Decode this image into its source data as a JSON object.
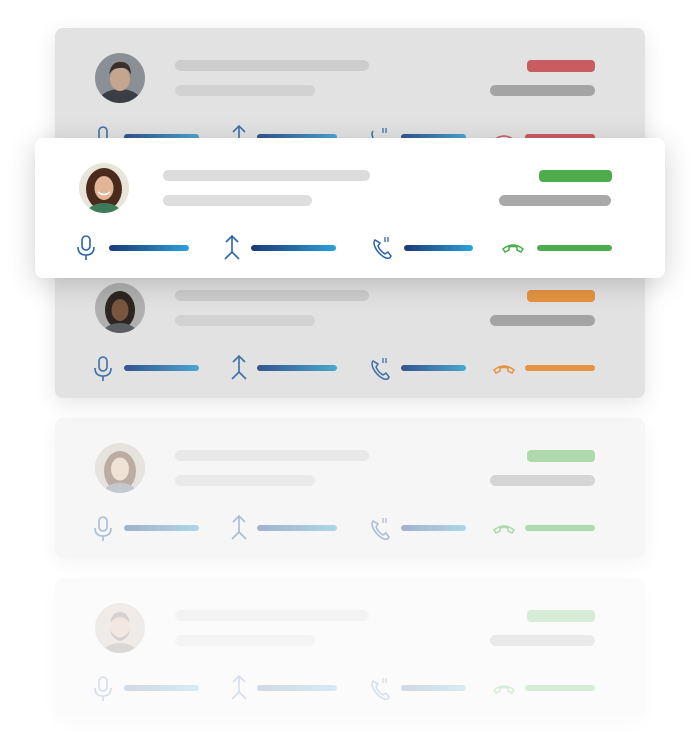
{
  "contacts": [
    {
      "name": "contact-card-1",
      "status": "red",
      "status_color": "#c95c61",
      "avatar": "man-short-dark-hair",
      "state": "dimmed"
    },
    {
      "name": "contact-card-2",
      "status": "green",
      "status_color": "#4cad4c",
      "avatar": "woman-curly-brown-hair",
      "state": "active"
    },
    {
      "name": "contact-card-3",
      "status": "orange",
      "status_color": "#e69341",
      "avatar": "woman-dark-hair",
      "state": "dimmed"
    },
    {
      "name": "contact-card-4",
      "status": "green",
      "status_color": "#4cad4c",
      "avatar": "woman-long-hair",
      "state": "faded"
    },
    {
      "name": "contact-card-5",
      "status": "green",
      "status_color": "#4cad4c",
      "avatar": "man-beard",
      "state": "faded"
    }
  ],
  "icons": {
    "microphone": "microphone-icon",
    "merge": "merge-arrow-icon",
    "phone_calling": "phone-ringing-icon",
    "hang_up": "hang-up-icon"
  },
  "colors": {
    "metric_gradient_start": "#1b3875",
    "metric_gradient_end": "#2aa2dc",
    "green": "#4cad4c",
    "red": "#c95c61",
    "orange": "#e69341"
  }
}
